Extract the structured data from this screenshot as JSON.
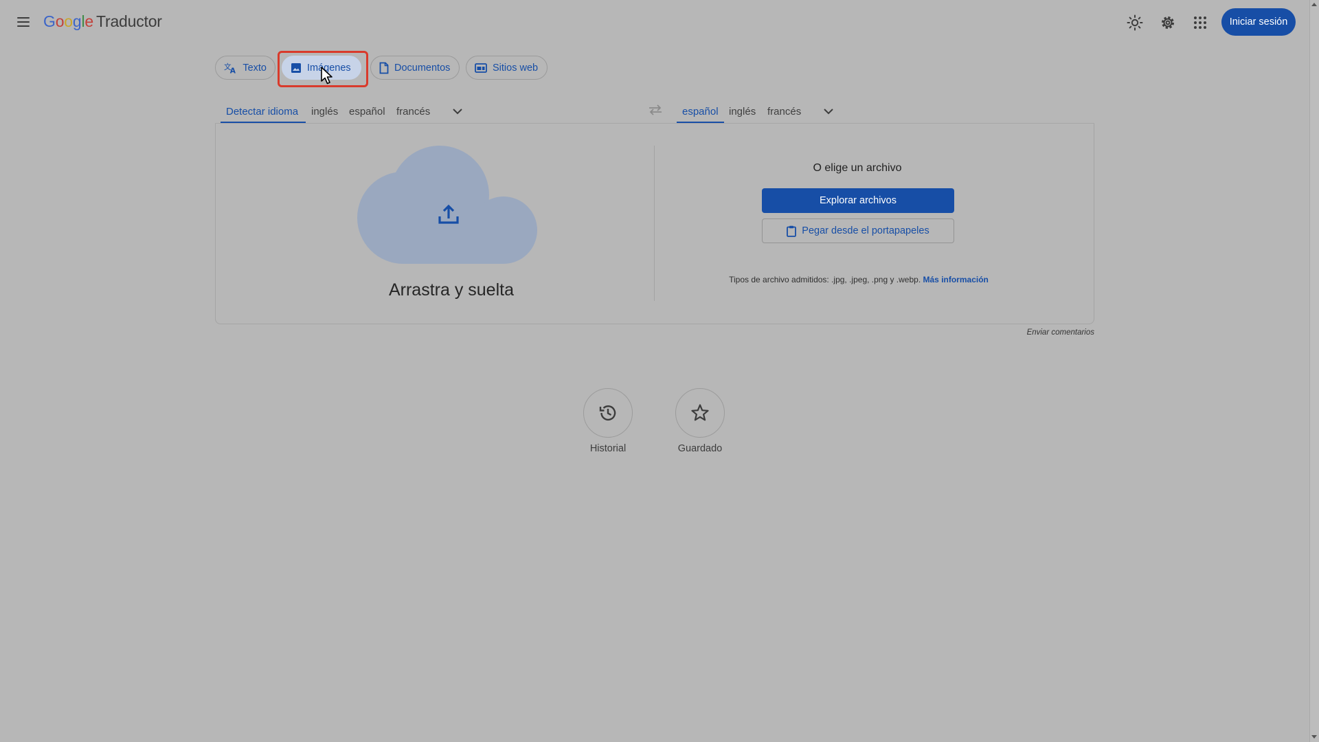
{
  "header": {
    "logo_letters": [
      "G",
      "o",
      "o",
      "g",
      "l",
      "e"
    ],
    "product": "Traductor",
    "signin_label": "Iniciar sesión",
    "icons": [
      "menu-icon",
      "brightness-icon",
      "settings-icon",
      "apps-grid-icon"
    ]
  },
  "modes": {
    "text": "Texto",
    "images": "Imágenes",
    "documents": "Documentos",
    "websites": "Sitios web",
    "active": "Imágenes"
  },
  "source_langs": {
    "detect": "Detectar idioma",
    "items": [
      "inglés",
      "español",
      "francés"
    ]
  },
  "target_langs": {
    "items": [
      "español",
      "inglés",
      "francés"
    ],
    "active": "español"
  },
  "upload": {
    "dropzone_label": "Arrastra y suelta",
    "choose_title": "O elige un archivo",
    "explore_label": "Explorar archivos",
    "paste_label": "Pegar desde el portapapeles",
    "filetypes_text": "Tipos de archivo admitidos: .jpg, .jpeg, .png y .webp.",
    "more_info_label": "Más información"
  },
  "feedback_label": "Enviar comentarios",
  "bottom": {
    "history_label": "Historial",
    "saved_label": "Guardado"
  },
  "colors": {
    "accent": "#174ea6",
    "background": "#b7b7b7",
    "cloud": "#9aa8bf",
    "highlight": "#d93a2b"
  }
}
